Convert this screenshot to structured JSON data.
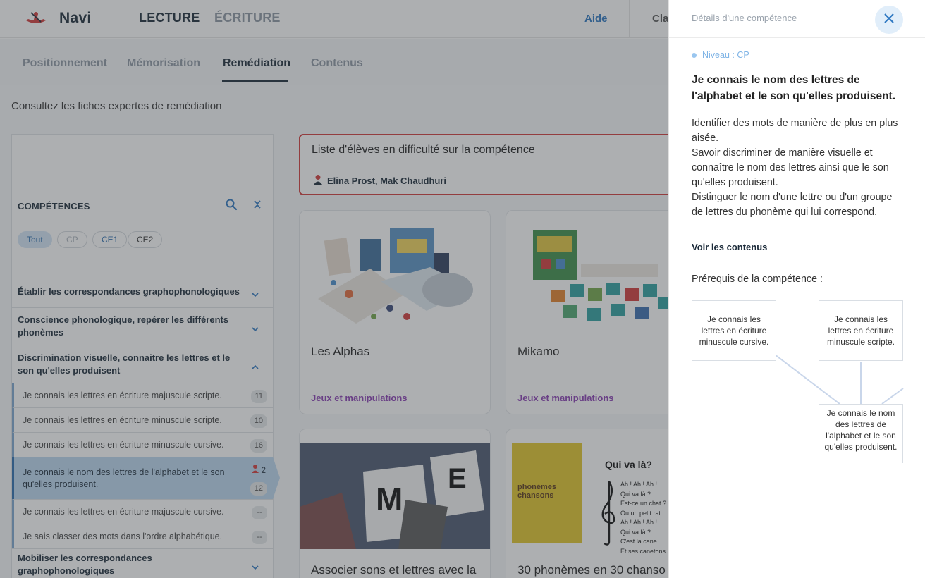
{
  "header": {
    "brand": "Navi",
    "tabs": [
      "LECTURE",
      "ÉCRITURE"
    ],
    "help": "Aide",
    "class_truncated": "Cla"
  },
  "subnav": {
    "items": [
      "Positionnement",
      "Mémorisation",
      "Remédiation",
      "Contenus"
    ],
    "active": "Remédiation"
  },
  "intro": "Consultez les fiches expertes de remédiation",
  "sidebar": {
    "title": "COMPÉTENCES",
    "filters": [
      "Tout",
      "CP",
      "CE1",
      "CE2"
    ],
    "categories": [
      {
        "label": "Établir les correspondances graphophonologiques"
      },
      {
        "label": "Conscience phonologique, repérer les différents phonèmes"
      },
      {
        "label": "Discrimination visuelle, connaitre les lettres et le son qu'elles produisent"
      },
      {
        "label": "Mobiliser les correspondances graphophonologiques"
      }
    ],
    "skills": [
      {
        "label": "Je connais les lettres en écriture majuscule scripte.",
        "count": "11"
      },
      {
        "label": "Je connais les lettres en écriture minuscule scripte.",
        "count": "10"
      },
      {
        "label": "Je connais les lettres en écriture minuscule cursive.",
        "count": "16"
      },
      {
        "label": "Je connais le nom des lettres de l'alphabet et le son qu'elles produisent.",
        "students": "2",
        "count": "12"
      },
      {
        "label": "Je connais les lettres en écriture majuscule cursive.",
        "count": "--"
      },
      {
        "label": "Je sais classer des mots dans l'ordre alphabétique.",
        "count": "--"
      }
    ]
  },
  "difficulty": {
    "title": "Liste d'élèves en difficulté sur la compétence",
    "students": "Elina Prost, Mak Chaudhuri"
  },
  "cards": [
    {
      "title": "Les Alphas",
      "category": "Jeux et manipulations"
    },
    {
      "title": "Mikamo",
      "category": "Jeux et manipulations"
    },
    {
      "title": "Associer sons et lettres avec la",
      "category": ""
    },
    {
      "title": "30 phonèmes en 30 chanso",
      "category": ""
    }
  ],
  "book": {
    "cover_title": "phonèmes chansons",
    "song_title": "Qui va là?",
    "song_lines": [
      "Ah ! Ah ! Ah !",
      "Qui va là ?",
      "Est-ce un chat ?",
      "Ou un petit rat",
      "Ah ! Ah ! Ah !",
      "Qui va là ?",
      "C'est la cane",
      "Et ses canetons"
    ]
  },
  "image_letters": [
    "M",
    "E"
  ],
  "panel": {
    "header": "Détails d'une compétence",
    "level": "Niveau : CP",
    "heading": "Je connais le nom des lettres de l'alphabet et le son qu'elles produisent.",
    "description": "Identifier des mots de manière de plus en plus aisée.\nSavoir discriminer de manière visuelle et connaître le nom des lettres ainsi que le son qu'elles produisent.\nDistinguer le nom d'une lettre ou d'un groupe de lettres du phonème qui lui correspond.",
    "link": "Voir les contenus",
    "prereq_label": "Prérequis de la compétence :",
    "prereq_nodes": [
      "Je connais les lettres en écriture minuscule cursive.",
      "Je connais les lettres en écriture minuscule scripte.",
      "Je connais le nom des lettres de l'alphabet et le son qu'elles produisent."
    ]
  },
  "colors": {
    "accent_blue": "#2e78c2",
    "difficulty_red": "#d23b3b",
    "category_purple": "#8a3fb4",
    "selected_row": "#bcd8f0"
  },
  "icons": [
    "canoe-logo-icon",
    "search-icon",
    "collapse-icon",
    "chevron-down-icon",
    "chevron-up-icon",
    "student-icon",
    "close-icon",
    "dot-icon"
  ]
}
